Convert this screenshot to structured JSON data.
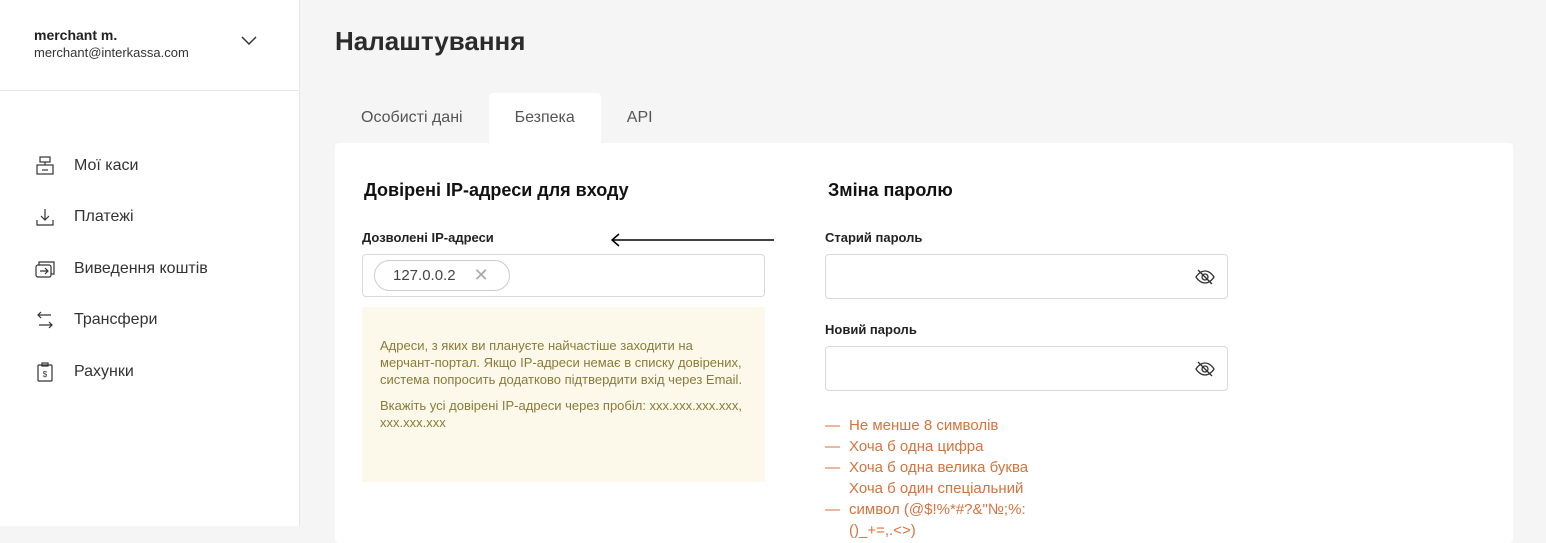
{
  "user": {
    "name": "merchant m.",
    "email": "merchant@interkassa.com"
  },
  "nav": [
    {
      "label": "Мої каси",
      "icon": "cash-register-icon"
    },
    {
      "label": "Платежі",
      "icon": "download-icon"
    },
    {
      "label": "Виведення коштів",
      "icon": "withdraw-icon"
    },
    {
      "label": "Трансфери",
      "icon": "transfer-icon"
    },
    {
      "label": "Рахунки",
      "icon": "invoice-icon"
    }
  ],
  "page_title": "Налаштування",
  "tabs": [
    {
      "label": "Особисті дані"
    },
    {
      "label": "Безпека",
      "active": true
    },
    {
      "label": "API"
    }
  ],
  "ip": {
    "title": "Довірені IP-адреси для входу",
    "label": "Дозволені IP-адреси",
    "chips": [
      "127.0.0.2"
    ],
    "info1": "Адреси, з яких ви плануєте найчастіше заходити на мерчант-портал. Якщо IP-адреси немає в списку довірених, система попросить додатково підтвердити вхід через Email.",
    "info2": "Вкажіть усі довірені IP-адреси через пробіл: xxx.xxx.xxx.xxx, xxx.xxx.xxx"
  },
  "password": {
    "title": "Зміна паролю",
    "old_label": "Старий пароль",
    "new_label": "Новий пароль",
    "requirements": [
      "Не менше 8 символів",
      "Хоча б одна цифра",
      "Хоча б одна велика буква",
      "Хоча б один спеціальний символ (@$!%*#?&\"№;%:()_+=,.<>)"
    ]
  },
  "colors": {
    "accent_warning": "#d4733e",
    "info_bg": "#fdf9ea",
    "info_text": "#8b7a3a"
  }
}
